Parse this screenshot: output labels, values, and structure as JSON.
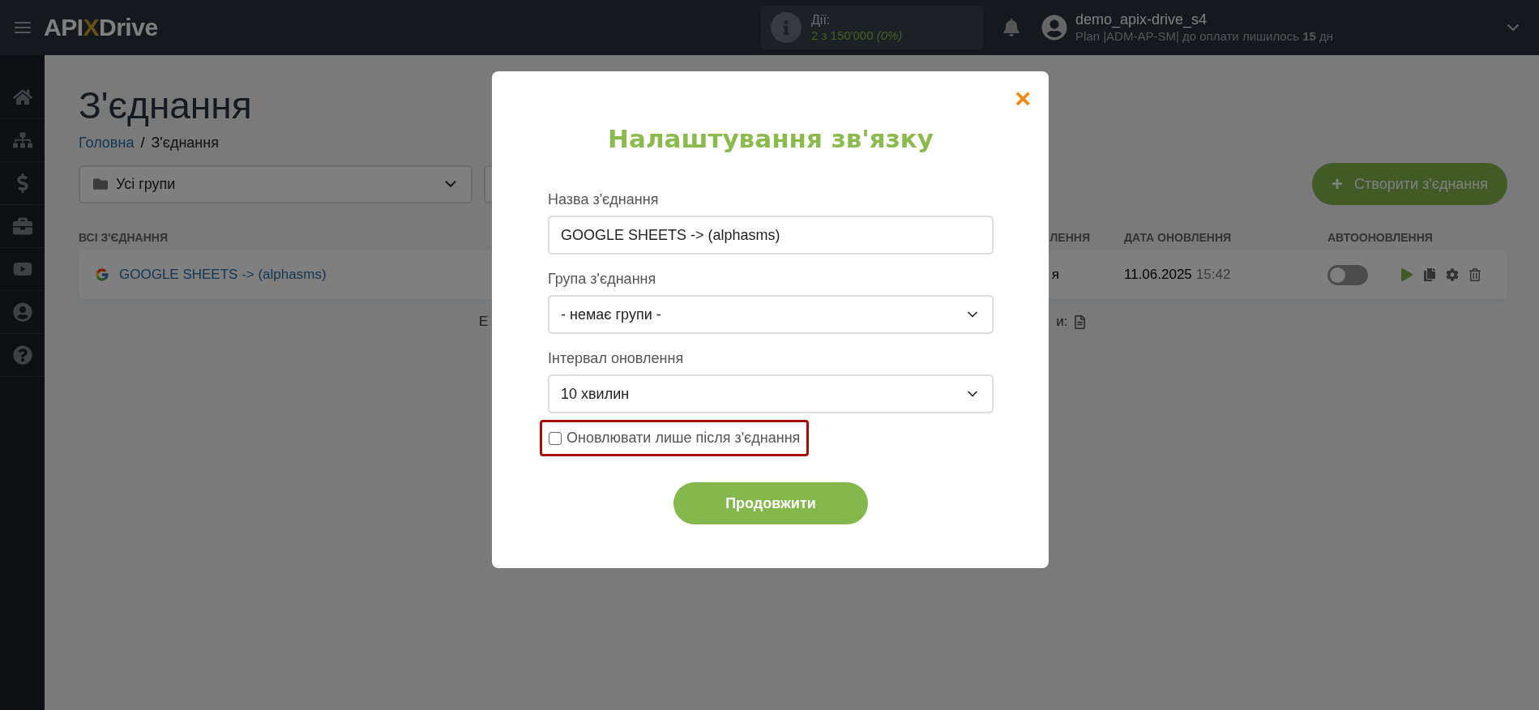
{
  "topbar": {
    "logo": [
      "API",
      "X",
      "Drive"
    ],
    "actions": {
      "label": "Дії:",
      "value": "2 з 150'000 *(0%)*"
    },
    "user": {
      "name": "demo_apix-drive_s4",
      "plan": "Plan |ADM-AP-SM| до оплати лишилось **15** дн"
    }
  },
  "page": {
    "title": "З'єднання",
    "breadcrumb_separator": "/",
    "breadcrumb": [
      {
        "label": "Головна",
        "kind": "link"
      },
      {
        "label": "З'єднання",
        "kind": "current"
      }
    ],
    "group_filter": {
      "value": "Усі групи"
    },
    "create_button": {
      "icon": "+",
      "label": "Створити з'єднання"
    },
    "table": {
      "columns": [
        "ВСІ З'ЄДНАННЯ",
        "ЛЕННЯ",
        "ДАТА ОНОВЛЕННЯ",
        "АВТООНОВЛЕННЯ"
      ],
      "rows": [
        {
          "name": "GOOGLE SHEETS -> (alphasms)",
          "column_3": "я",
          "date": "11.06.2025",
          "time": "15:42",
          "autoupdate": false
        }
      ]
    },
    "footer_fragments": [
      "Е",
      "и:"
    ]
  },
  "modal": {
    "close": "×",
    "title": "Налаштування зв'язку",
    "fields": [
      {
        "kind": "input",
        "label": "Назва з'єднання",
        "value": "GOOGLE SHEETS -> (alphasms)"
      },
      {
        "kind": "select",
        "label": "Група з'єднання",
        "value": "- немає групи -"
      },
      {
        "kind": "select",
        "label": "Інтервал оновлення",
        "value": "10 хвилин"
      }
    ],
    "checkbox": {
      "label": "Оновлювати лише після з'єднання",
      "checked": false,
      "highlighted": true
    },
    "submit": "Продовжити"
  }
}
